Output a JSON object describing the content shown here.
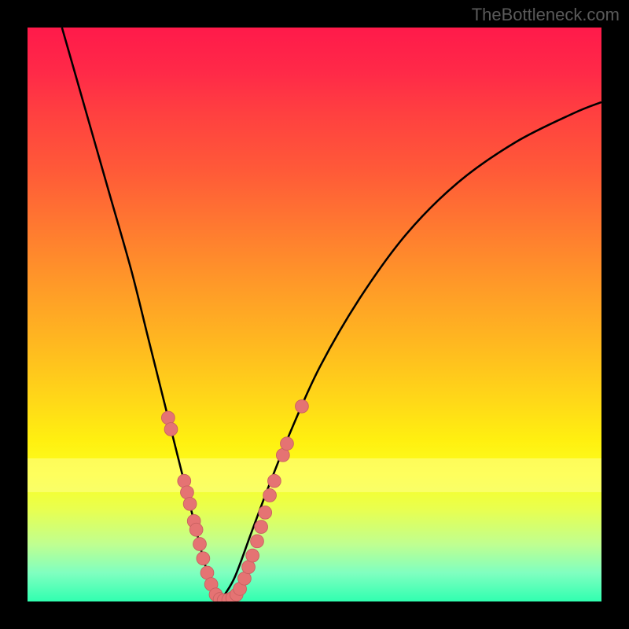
{
  "watermark": "TheBottleneck.com",
  "colors": {
    "background": "#000000",
    "curve_stroke": "#000000",
    "marker_fill": "#e57373",
    "marker_stroke": "#c86060"
  },
  "chart_data": {
    "type": "line",
    "title": "",
    "xlabel": "",
    "ylabel": "",
    "xlim": [
      0,
      100
    ],
    "ylim": [
      0,
      100
    ],
    "curve_left": {
      "name": "left-branch",
      "points": [
        {
          "x": 6,
          "y": 100
        },
        {
          "x": 10,
          "y": 86
        },
        {
          "x": 14,
          "y": 72
        },
        {
          "x": 18,
          "y": 58
        },
        {
          "x": 21,
          "y": 46
        },
        {
          "x": 23.5,
          "y": 36
        },
        {
          "x": 25.5,
          "y": 28
        },
        {
          "x": 27.5,
          "y": 20
        },
        {
          "x": 29,
          "y": 14
        },
        {
          "x": 30.5,
          "y": 8
        },
        {
          "x": 32,
          "y": 3
        },
        {
          "x": 33.5,
          "y": 0
        }
      ]
    },
    "curve_right": {
      "name": "right-branch",
      "points": [
        {
          "x": 33.5,
          "y": 0
        },
        {
          "x": 36,
          "y": 4
        },
        {
          "x": 39,
          "y": 12
        },
        {
          "x": 42,
          "y": 20
        },
        {
          "x": 46,
          "y": 30
        },
        {
          "x": 51,
          "y": 41
        },
        {
          "x": 58,
          "y": 53
        },
        {
          "x": 66,
          "y": 64
        },
        {
          "x": 75,
          "y": 73
        },
        {
          "x": 85,
          "y": 80
        },
        {
          "x": 95,
          "y": 85
        },
        {
          "x": 100,
          "y": 87
        }
      ]
    },
    "markers_left": [
      {
        "x": 24.5,
        "y": 32
      },
      {
        "x": 25,
        "y": 30
      },
      {
        "x": 27.3,
        "y": 21
      },
      {
        "x": 27.8,
        "y": 19
      },
      {
        "x": 28.3,
        "y": 17
      },
      {
        "x": 29,
        "y": 14
      },
      {
        "x": 29.4,
        "y": 12.5
      },
      {
        "x": 30,
        "y": 10
      },
      {
        "x": 30.6,
        "y": 7.5
      },
      {
        "x": 31.3,
        "y": 5
      },
      {
        "x": 32,
        "y": 3
      },
      {
        "x": 32.8,
        "y": 1.2
      },
      {
        "x": 33.5,
        "y": 0.4
      },
      {
        "x": 34.2,
        "y": 0.2
      },
      {
        "x": 35,
        "y": 0.3
      }
    ],
    "markers_right": [
      {
        "x": 35.7,
        "y": 0.6
      },
      {
        "x": 36.4,
        "y": 1.2
      },
      {
        "x": 37,
        "y": 2.2
      },
      {
        "x": 37.8,
        "y": 4
      },
      {
        "x": 38.5,
        "y": 6
      },
      {
        "x": 39.2,
        "y": 8
      },
      {
        "x": 40,
        "y": 10.5
      },
      {
        "x": 40.7,
        "y": 13
      },
      {
        "x": 41.4,
        "y": 15.5
      },
      {
        "x": 42.2,
        "y": 18.5
      },
      {
        "x": 43,
        "y": 21
      },
      {
        "x": 44.5,
        "y": 25.5
      },
      {
        "x": 45.2,
        "y": 27.5
      },
      {
        "x": 47.8,
        "y": 34
      }
    ]
  }
}
